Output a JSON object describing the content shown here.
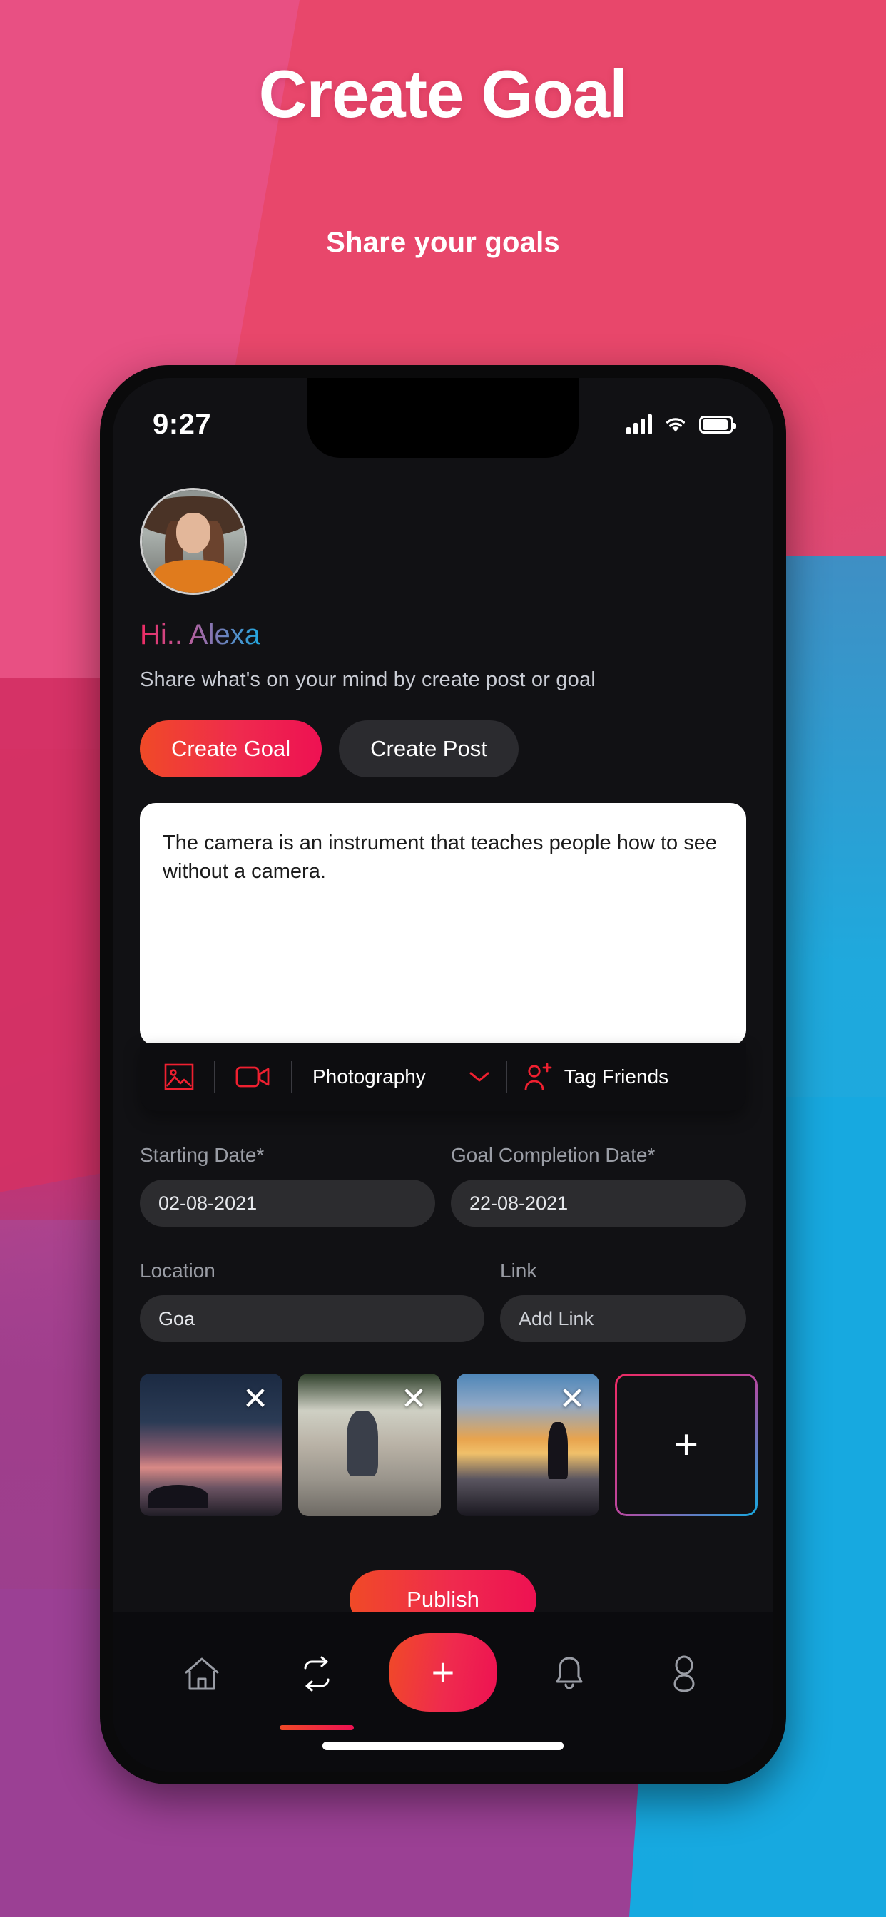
{
  "promo": {
    "title": "Create Goal",
    "subtitle": "Share your goals"
  },
  "statusbar": {
    "time": "9:27",
    "signal_icon": "cellular-signal-icon",
    "wifi_icon": "wifi-icon",
    "battery_icon": "battery-icon"
  },
  "profile": {
    "avatar_alt": "user-avatar",
    "greeting": "Hi.. Alexa",
    "tagline": "Share what's on your mind by create post or goal"
  },
  "tabs": [
    {
      "label": "Create Goal",
      "active": true
    },
    {
      "label": "Create Post",
      "active": false
    }
  ],
  "composer": {
    "text": "The camera is an instrument that teaches people how to see without a camera."
  },
  "toolbar": {
    "image_icon": "image-icon",
    "video_icon": "video-camera-icon",
    "category": "Photography",
    "chevron_icon": "chevron-down-icon",
    "tag_icon": "add-person-icon",
    "tag_label": "Tag Friends"
  },
  "fields": {
    "starting_date": {
      "label": "Starting Date*",
      "value": "02-08-2021"
    },
    "completion_date": {
      "label": "Goal Completion Date*",
      "value": "22-08-2021"
    },
    "location": {
      "label": "Location",
      "value": "Goa"
    },
    "link": {
      "label": "Link",
      "value": "Add Link"
    }
  },
  "media": {
    "remove_label": "✕",
    "add_label": "+",
    "thumbs": [
      {
        "alt": "sunset-lake-photo"
      },
      {
        "alt": "woman-on-boardwalk-photo"
      },
      {
        "alt": "person-watching-sunset-photo"
      }
    ]
  },
  "publish": {
    "label": "Publish"
  },
  "bottomnav": {
    "items": [
      {
        "icon": "home-icon",
        "active": false
      },
      {
        "icon": "repeat-icon",
        "active": true
      },
      {
        "icon": "plus-icon",
        "active": false
      },
      {
        "icon": "bell-icon",
        "active": false
      },
      {
        "icon": "person-icon",
        "active": false
      }
    ],
    "fab_label": "+"
  },
  "colors": {
    "accent_start": "#f04a27",
    "accent_end": "#ee1152",
    "gradient_blue": "#16a9e0",
    "gradient_pink": "#ef2a63",
    "screen_bg": "#111114"
  }
}
